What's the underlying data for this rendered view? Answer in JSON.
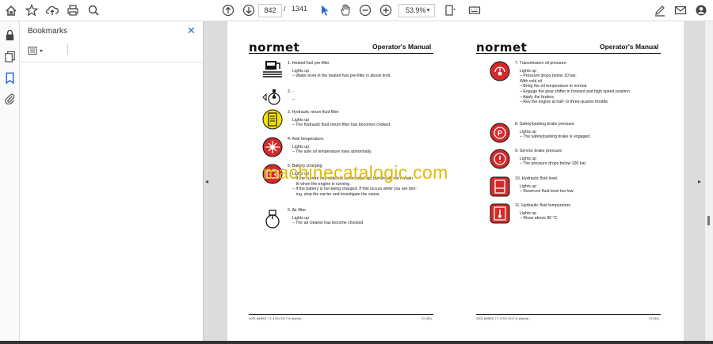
{
  "toolbar": {
    "page_current": "842",
    "page_sep": "/",
    "page_total": "1341",
    "zoom": "53.9%"
  },
  "panel": {
    "title": "Bookmarks",
    "close": "✕"
  },
  "left_page": {
    "logo": "normet",
    "header": "Operator's Manual",
    "items": [
      {
        "head": "1.    Heated fuel pre-filter",
        "lines": [
          "Lights up",
          "– Water level in the heated fuel pre-filter is above limit."
        ]
      },
      {
        "head": "2.    -",
        "lines": [
          "–"
        ]
      },
      {
        "head": "3.    Hydraulic return fluid filter",
        "lines": [
          "Lights up",
          "– The hydraulic fluid return filter has becomes choked."
        ]
      },
      {
        "head": "4.    Axle temperature.",
        "lines": [
          "Lights up",
          "– The axle oil temperature rises abnormally."
        ]
      },
      {
        "head": "5.    Battery charging",
        "lines": [
          "Lights up",
          "– If the current key switch is turned start-up, but should not remain",
          "lit when the engine is running.",
          "– If the battery is not being charged. If this occurs while you are driv-",
          "ing, stop the carrier and investigate the cause."
        ]
      },
      {
        "head": "6.    Air filter",
        "lines": [
          "Lights up",
          "– The air cleaner has become chocked"
        ]
      }
    ],
    "footer_left": "1001 [MB/D] 7.1.3 EN 2017-8 (Alpha) -",
    "footer_right": "22 (50)"
  },
  "right_page": {
    "logo": "normet",
    "header": "Operator's Manual",
    "items": [
      {
        "head": "7.    Transmission oil pressure",
        "lines": [
          "Lights up",
          "– Pressure drops below 10 bar.",
          "With cold oil",
          "– Bring the oil temperature to normal.",
          "– Engage the gear shifter in forward and high speed position.",
          "– Apply the brakes.",
          "– Rev the engine at half- to three-quarter throttle."
        ]
      },
      {
        "head": "8.    Safety/parking brake pressure",
        "lines": [
          "Lights up",
          "– The safety/parking brake is engaged."
        ]
      },
      {
        "head": "9.    Service brake pressure",
        "lines": [
          "Lights up",
          "– The pressure drops below 100 bar."
        ]
      },
      {
        "head": "10.  Hydraulic fluid level",
        "lines": [
          "Lights up",
          "– Reservoir fluid level too low."
        ]
      },
      {
        "head": "11.  Hydraulic fluid temperature",
        "lines": [
          "Lights up",
          "– Rises above 80 °C"
        ]
      }
    ],
    "footer_left": "1001 [MB/D] 7.1.3 EN 2017-8 (Alpha) -",
    "footer_right": "23 (50)"
  },
  "watermark": "machinecatalogic.com",
  "colors": {
    "accent": "#2b6cd4",
    "warning_red": "#d42a2a",
    "warning_yellow": "#f4e200",
    "watermark": "#e0bb0c"
  }
}
